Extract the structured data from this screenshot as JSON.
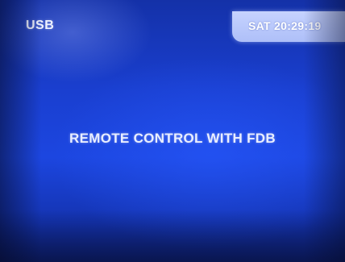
{
  "header": {
    "source": "USB",
    "clock": "SAT 20:29:19"
  },
  "main": {
    "message": "REMOTE CONTROL WITH FDB"
  },
  "colors": {
    "screen_background": "#1c46e0",
    "clock_panel": "#b8c8ff",
    "text": "#eef2ff"
  }
}
